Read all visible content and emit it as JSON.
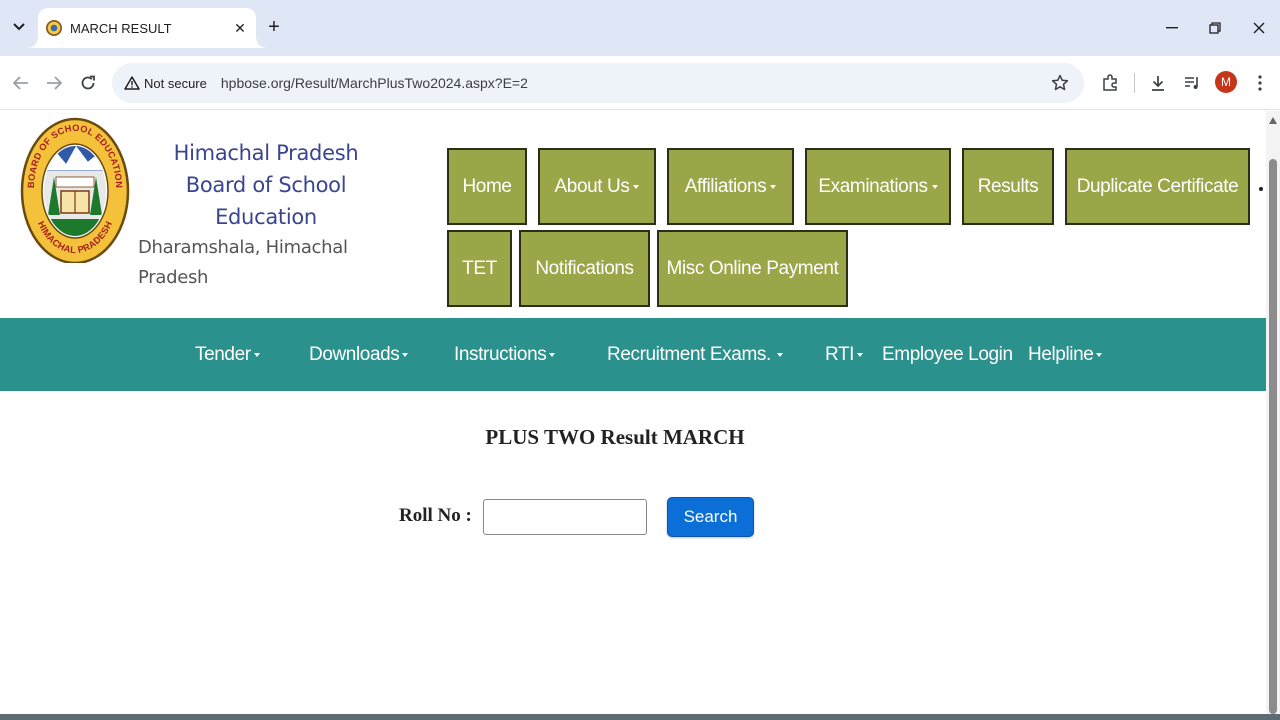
{
  "browser": {
    "tab_title": "MARCH RESULT",
    "security_label": "Not secure",
    "url": "hpbose.org/Result/MarchPlusTwo2024.aspx?E=2",
    "profile_initial": "M"
  },
  "logo": {
    "ring_text_top": "BOARD OF SCHOOL EDUCATION",
    "ring_text_bottom": "HIMACHAL PRADESH"
  },
  "brand": {
    "line1": "Himachal Pradesh",
    "line2": "Board of School Education",
    "line3": "Dharamshala, Himachal Pradesh"
  },
  "top_nav": {
    "home": "Home",
    "about": "About Us",
    "affiliations": "Affiliations",
    "examinations": "Examinations",
    "results": "Results",
    "duplicate": "Duplicate Certificate",
    "tet": "TET",
    "notifications": "Notifications",
    "misc_payment": "Misc Online Payment"
  },
  "main_nav": {
    "tender": "Tender",
    "downloads": "Downloads",
    "instructions": "Instructions",
    "recruitment": "Recruitment Exams.",
    "rti": "RTI",
    "employee_login": "Employee Login",
    "helpline": "Helpline"
  },
  "form": {
    "title": "PLUS TWO Result MARCH",
    "roll_label": "Roll No :",
    "roll_value": "",
    "search_label": "Search"
  },
  "colors": {
    "olive": "#9ba649",
    "teal": "#2b918d",
    "brand_blue": "#3a4592",
    "search_blue": "#0c6fd8"
  }
}
